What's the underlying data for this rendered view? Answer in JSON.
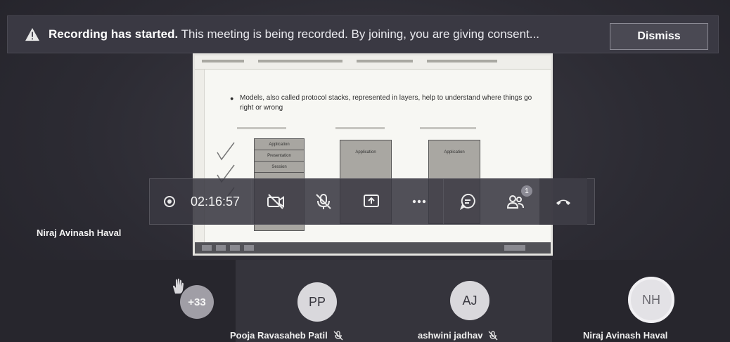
{
  "banner": {
    "title": "Recording has started.",
    "message": " This meeting is being recorded. By joining, you are giving consent...",
    "dismiss_label": "Dismiss"
  },
  "presentation": {
    "bullet_text": "Models, also called protocol stacks, represented in layers, help to understand where things go right or wrong",
    "stack_layers": [
      "Application",
      "Presentation",
      "Session"
    ],
    "box_label": "Application"
  },
  "controls": {
    "timer": "02:16:57",
    "participants_badge": "1",
    "icons": [
      "record-icon",
      "camera-off-icon",
      "mic-off-icon",
      "share-icon",
      "more-icon",
      "chat-icon",
      "participants-icon",
      "hang-up-icon"
    ]
  },
  "presenter": {
    "name": "Niraj Avinash Haval"
  },
  "participants": [
    {
      "initials": "+33",
      "name": ""
    },
    {
      "initials": "PP",
      "name": "Pooja Ravasaheb Patil"
    },
    {
      "initials": "AJ",
      "name": "ashwini jadhav"
    },
    {
      "initials": "NH",
      "name": "Niraj Avinash Haval"
    }
  ],
  "colors": {
    "background": "#2c2b33",
    "banner": "#3a3943",
    "control_bar": "#3a3942"
  }
}
